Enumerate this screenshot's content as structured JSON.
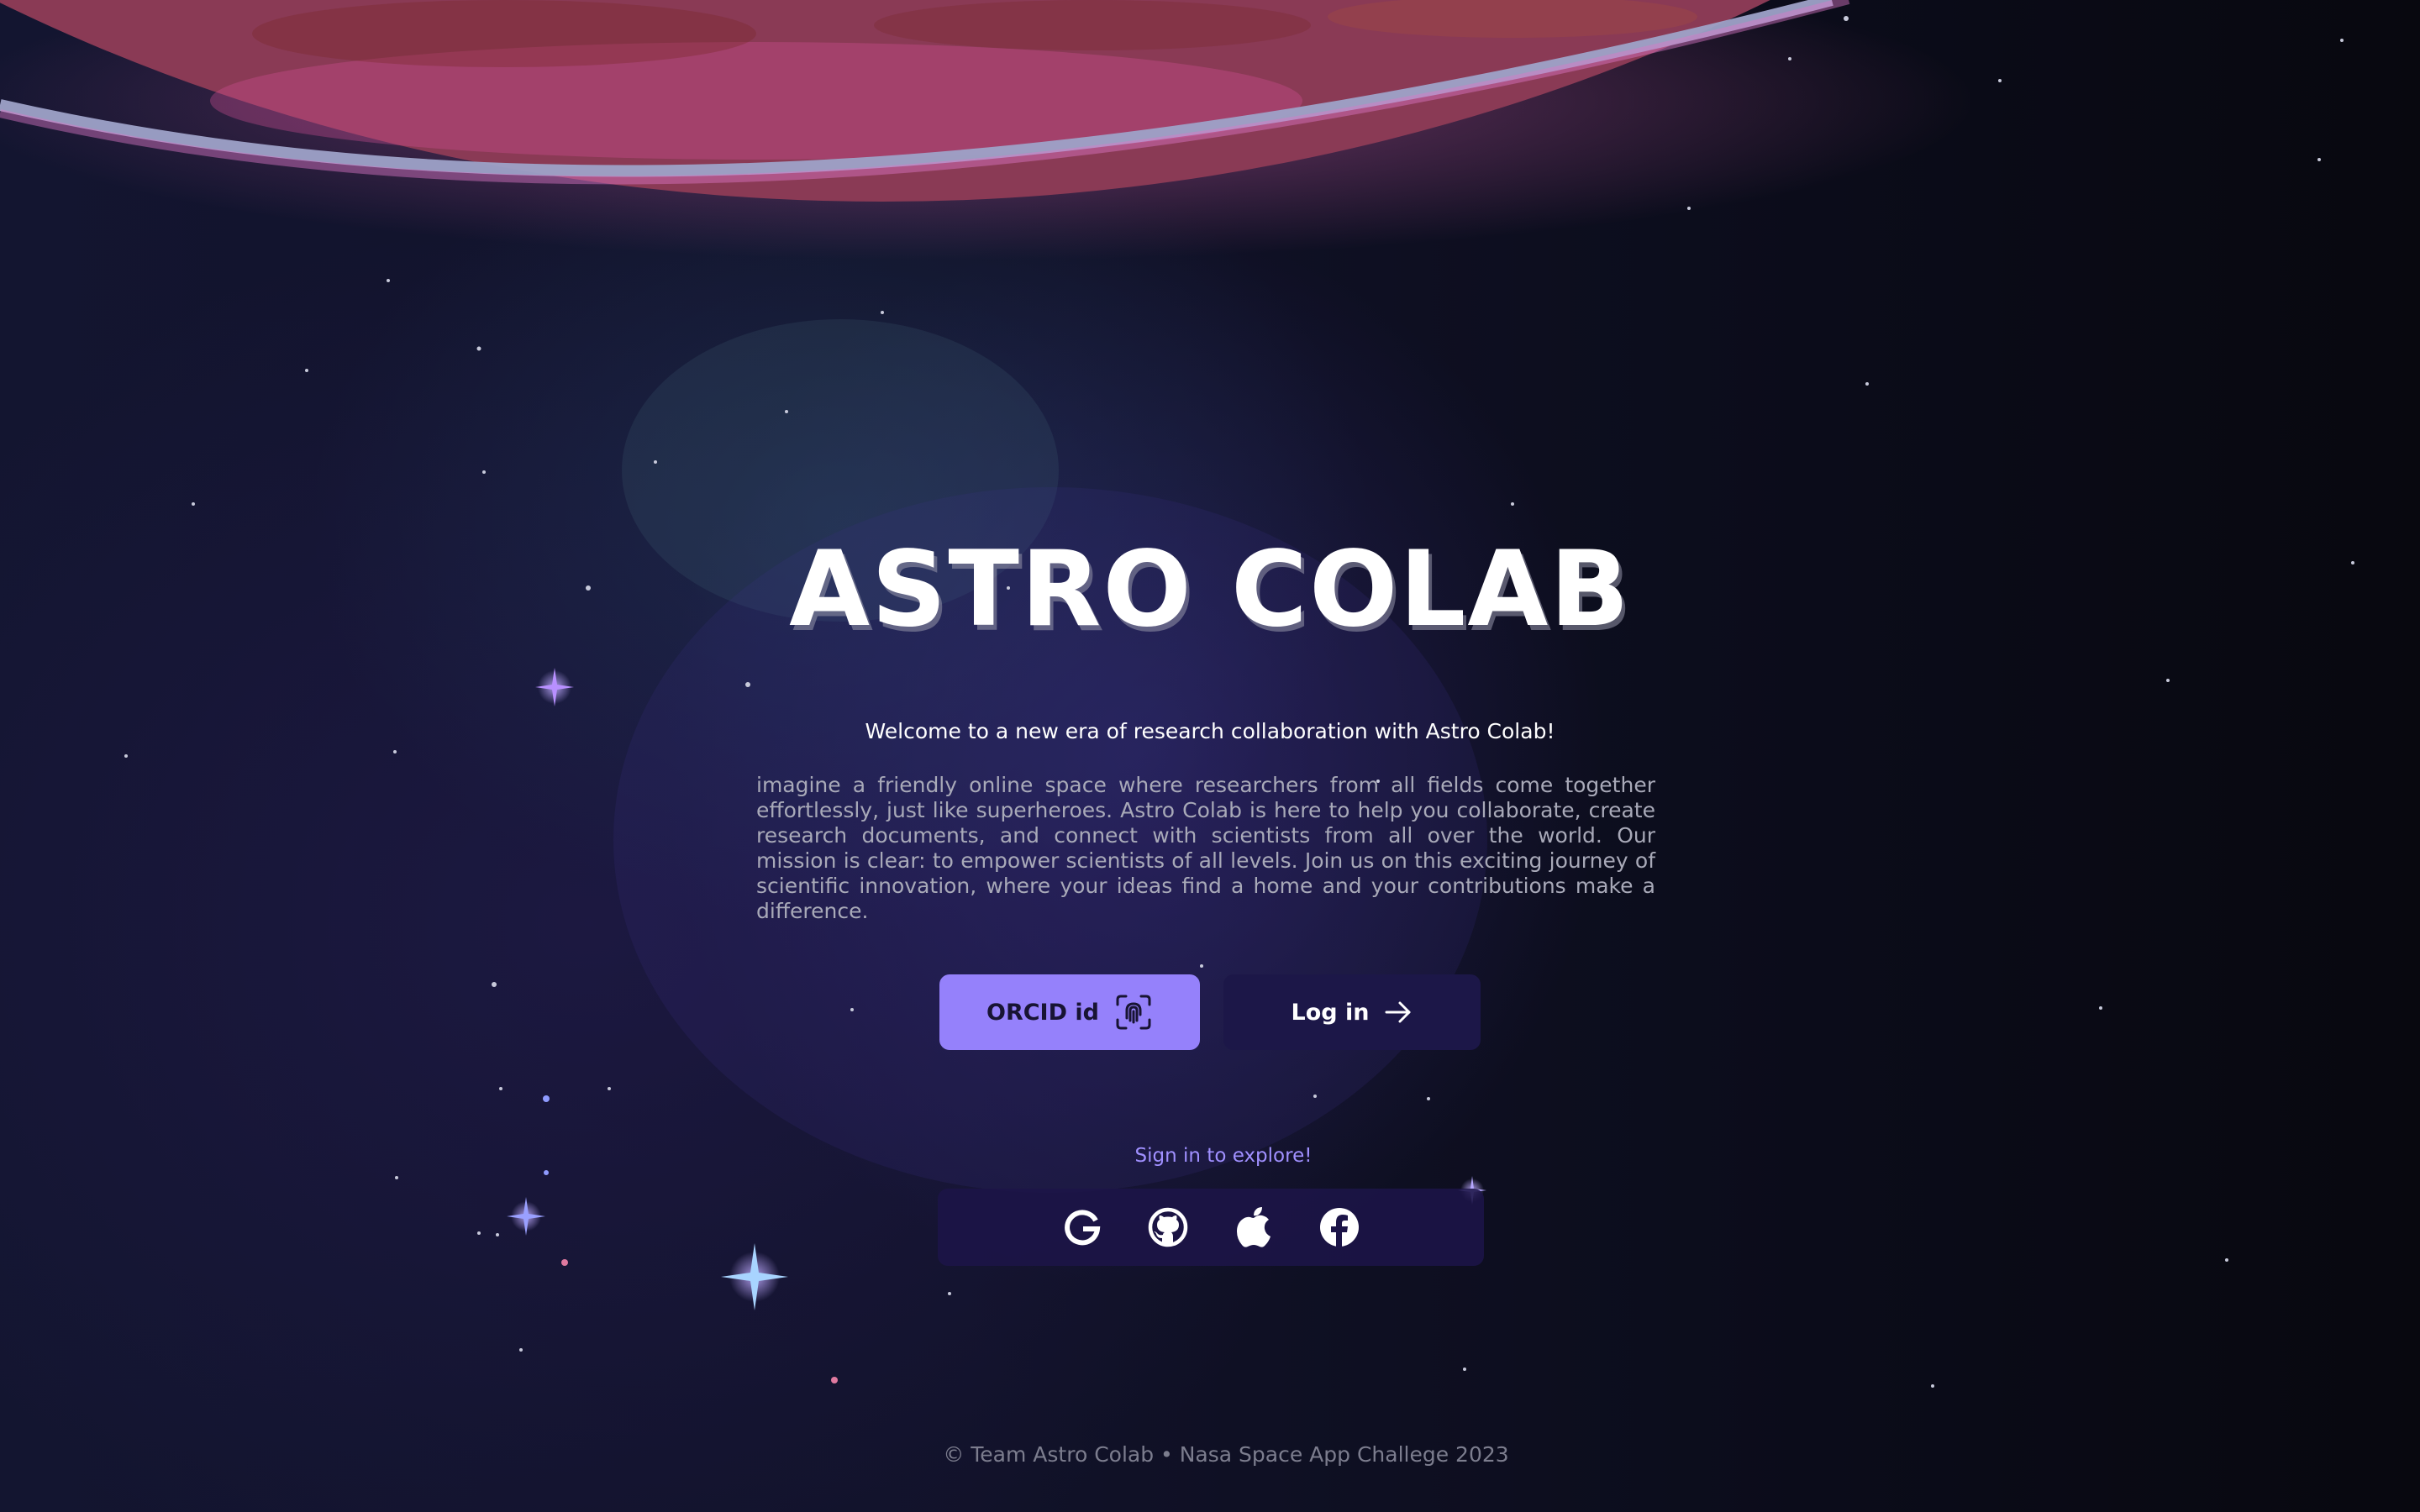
{
  "hero": {
    "title": "ASTRO COLAB",
    "welcome": "Welcome to a new era of research collaboration with Astro Colab!",
    "description": "imagine a friendly online space where researchers from all fields come together effortlessly, just like superheroes. Astro Colab is here to help you collaborate, create research documents, and connect with scientists from all over the world. Our mission is clear: to empower scientists of all levels. Join us on this exciting journey of scientific innovation, where your ideas find a home and your contributions make a difference."
  },
  "buttons": {
    "orcid_label": "ORCID id",
    "orcid_icon": "fingerprint-icon",
    "login_label": "Log in",
    "login_icon": "arrow-right-icon"
  },
  "social": {
    "label": "Sign in to explore!",
    "providers": [
      {
        "name": "Google",
        "icon": "google-icon"
      },
      {
        "name": "GitHub",
        "icon": "github-icon"
      },
      {
        "name": "Apple",
        "icon": "apple-icon"
      },
      {
        "name": "Facebook",
        "icon": "facebook-icon"
      }
    ]
  },
  "footer": {
    "text": "© Team Astro Colab • Nasa Space App Challege 2023"
  },
  "colors": {
    "primary_button": "#9581fb",
    "secondary_button": "#1c1748",
    "accent_text": "#a090ff",
    "background": "#0a0b16",
    "planet": "#a84a3e"
  }
}
